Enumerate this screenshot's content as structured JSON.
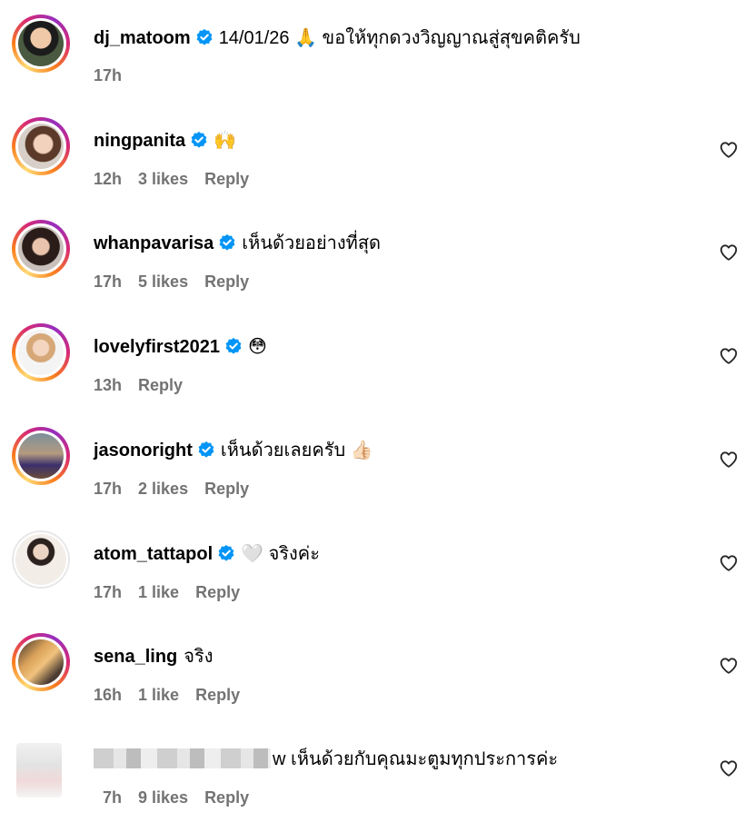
{
  "heart_icon": "heart-outline-icon",
  "verified_icon": "verified-badge-icon",
  "colors": {
    "verified": "#0095f6",
    "meta_text": "#737373"
  },
  "comments": [
    {
      "username": "dj_matoom",
      "verified": true,
      "text": "14/01/26 🙏 ขอให้ทุกดวงวิญญาณสู่สุขคติครับ",
      "time": "17h",
      "likes": "",
      "reply": ""
    },
    {
      "username": "ningpanita",
      "verified": true,
      "text": "🙌",
      "time": "12h",
      "likes": "3 likes",
      "reply": "Reply"
    },
    {
      "username": "whanpavarisa",
      "verified": true,
      "text": "เห็นด้วยอย่างที่สุด",
      "time": "17h",
      "likes": "5 likes",
      "reply": "Reply"
    },
    {
      "username": "lovelyfirst2021",
      "verified": true,
      "text": "😳",
      "time": "13h",
      "likes": "",
      "reply": "Reply"
    },
    {
      "username": "jasonoright",
      "verified": true,
      "text": "เห็นด้วยเลยครับ 👍🏻",
      "time": "17h",
      "likes": "2 likes",
      "reply": "Reply"
    },
    {
      "username": "atom_tattapol",
      "verified": true,
      "text": "🤍 จริงค่ะ",
      "time": "17h",
      "likes": "1 like",
      "reply": "Reply"
    },
    {
      "username": "sena_ling",
      "verified": false,
      "text": "จริง",
      "time": "16h",
      "likes": "1 like",
      "reply": "Reply"
    },
    {
      "username": "",
      "verified": false,
      "text": "w เห็นด้วยกับคุณมะตูมทุกประการค่ะ",
      "time": "7h",
      "likes": "9 likes",
      "reply": "Reply"
    }
  ]
}
